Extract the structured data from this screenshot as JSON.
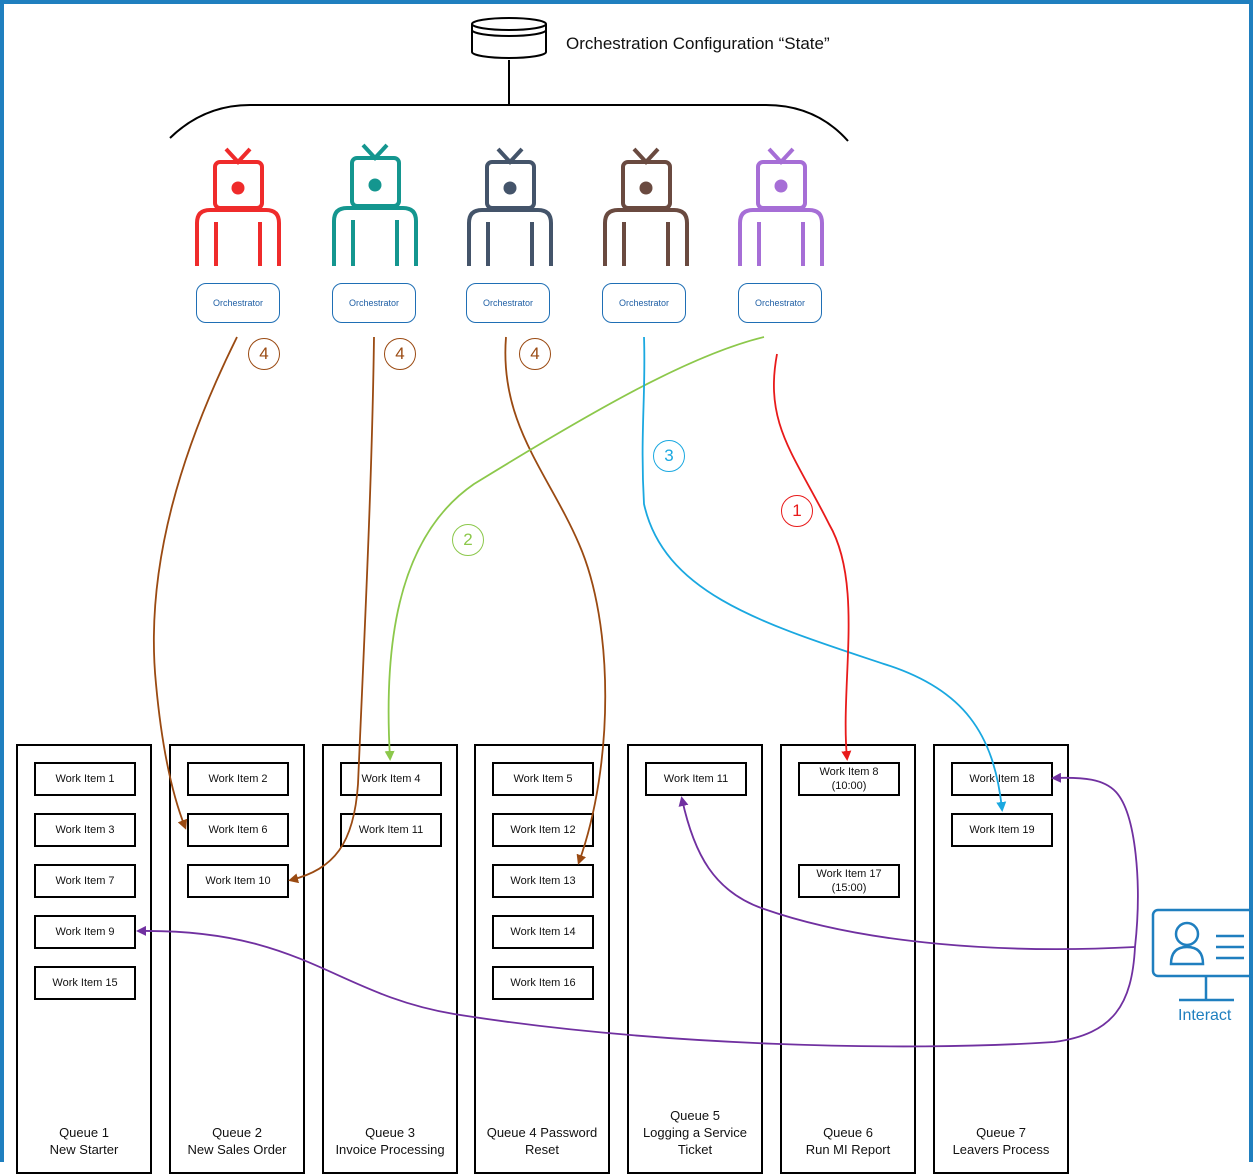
{
  "title": "Orchestration Configuration “State”",
  "icons": {
    "database": "database-icon",
    "robot": "robot-icon",
    "interact": "user-list-monitor-icon"
  },
  "colors": {
    "red": "#ef2b2b",
    "teal": "#14968f",
    "slate": "#44546a",
    "brown": "#6a4a40",
    "purple": "#a66ed6",
    "orange_arrow": "#9a4a12",
    "green_arrow": "#8cc84b",
    "blue_arrow": "#1aa8e0",
    "red_arrow": "#e81a1a",
    "violet_arrow": "#7030a0",
    "interact": "#1f7fbf"
  },
  "orchestrator_label": "Orchestrator",
  "steps": {
    "s4a": "4",
    "s4b": "4",
    "s4c": "4",
    "s3": "3",
    "s2": "2",
    "s1": "1"
  },
  "interact_label": "Interact",
  "queues": [
    {
      "label": "Queue 1\nNew Starter",
      "items": [
        "Work Item 1",
        "Work Item 3",
        "Work Item 7",
        "Work Item 9",
        "Work Item 15"
      ]
    },
    {
      "label": "Queue 2\nNew Sales Order",
      "items": [
        "Work Item 2",
        "Work Item 6",
        "Work Item 10"
      ]
    },
    {
      "label": "Queue 3\nInvoice Processing",
      "items": [
        "Work Item 4",
        "Work Item 11"
      ]
    },
    {
      "label": "Queue 4 Password\nReset",
      "items": [
        "Work Item 5",
        "Work Item 12",
        "Work Item 13",
        "Work Item 14",
        "Work Item 16"
      ]
    },
    {
      "label": "Queue 5\nLogging a Service\nTicket",
      "items": [
        "Work Item 11"
      ]
    },
    {
      "label": "Queue 6\nRun MI Report",
      "items": [
        "Work Item 8\n(10:00)",
        "Work Item 17\n(15:00)"
      ]
    },
    {
      "label": "Queue 7\nLeavers Process",
      "items": [
        "Work Item 18",
        "Work Item 19"
      ]
    }
  ]
}
